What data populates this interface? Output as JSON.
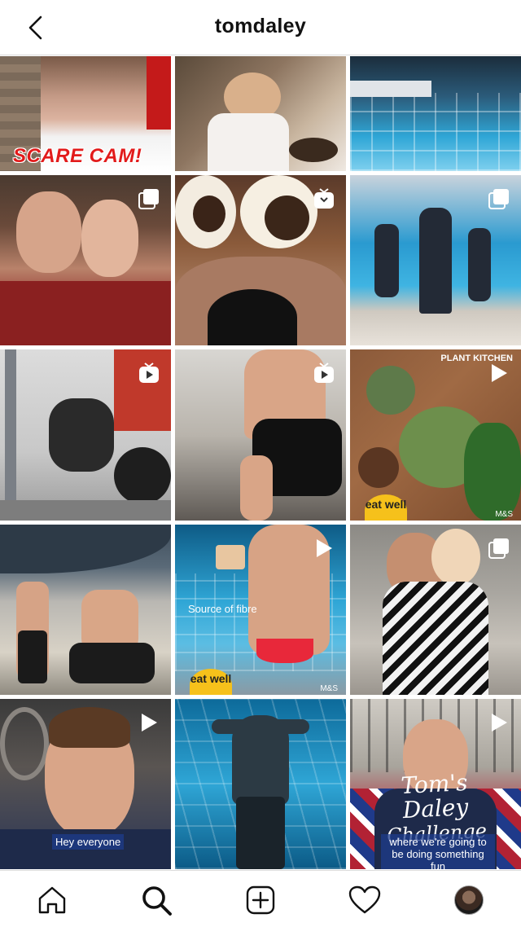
{
  "header": {
    "title": "tomdaley",
    "back_icon": "chevron-left-icon"
  },
  "grid": {
    "tiles": [
      {
        "row": 0,
        "col": 0,
        "caption": "SCARE CAM!",
        "badge": ""
      },
      {
        "row": 0,
        "col": 1,
        "caption": "",
        "badge": ""
      },
      {
        "row": 0,
        "col": 2,
        "caption": "",
        "badge": ""
      },
      {
        "row": 1,
        "col": 0,
        "caption": "",
        "badge": "carousel-icon"
      },
      {
        "row": 1,
        "col": 1,
        "caption": "",
        "badge": "igtv-icon"
      },
      {
        "row": 1,
        "col": 2,
        "caption": "",
        "badge": "carousel-icon"
      },
      {
        "row": 2,
        "col": 0,
        "caption": "",
        "badge": "igtv-icon"
      },
      {
        "row": 2,
        "col": 1,
        "caption": "",
        "badge": "igtv-icon"
      },
      {
        "row": 2,
        "col": 2,
        "caption": "",
        "badge": "play-icon"
      },
      {
        "row": 3,
        "col": 0,
        "caption": "",
        "badge": ""
      },
      {
        "row": 3,
        "col": 1,
        "caption": "Source of fibre",
        "badge": "play-icon"
      },
      {
        "row": 3,
        "col": 2,
        "caption": "",
        "badge": "carousel-icon"
      },
      {
        "row": 4,
        "col": 0,
        "caption": "Hey everyone",
        "badge": "play-icon"
      },
      {
        "row": 4,
        "col": 1,
        "caption": "",
        "badge": ""
      },
      {
        "row": 4,
        "col": 2,
        "caption": "where we're going to be doing something fun",
        "badge": "play-icon"
      }
    ],
    "eat_well_label": "eat well",
    "ms_label": "M&S",
    "plant_kitchen_label": "PLANT KITCHEN",
    "challenge_title": "Tom's Daley",
    "challenge_subtitle": "Challenge"
  },
  "tabbar": {
    "items": [
      {
        "name": "home",
        "icon": "home-icon"
      },
      {
        "name": "search",
        "icon": "search-icon"
      },
      {
        "name": "new-post",
        "icon": "plus-square-icon"
      },
      {
        "name": "activity",
        "icon": "heart-icon"
      },
      {
        "name": "profile",
        "icon": "avatar"
      }
    ]
  },
  "colors": {
    "pool_blue": "#2fa6d6",
    "scare_red": "#e21b1b",
    "eat_well_yellow": "#f6c11b",
    "divider": "#dbdbdb"
  }
}
